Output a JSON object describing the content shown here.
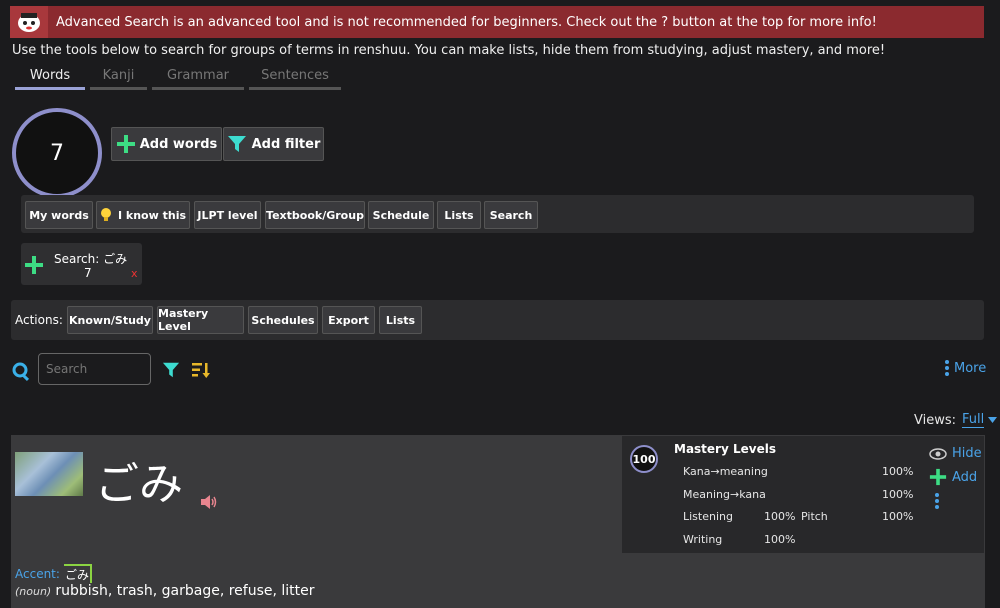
{
  "banner": {
    "text": "Advanced Search is an advanced tool and is not recommended for beginners. Check out the ? button at the top for more info!"
  },
  "intro": "Use the tools below to search for groups of terms in renshuu. You can make lists, hide them from studying, adjust mastery, and more!",
  "tabs": [
    "Words",
    "Kanji",
    "Grammar",
    "Sentences"
  ],
  "result_count": "7",
  "add_words_label": "Add words",
  "add_filter_label": "Add filter",
  "filters": [
    "My words",
    "I know this",
    "JLPT level",
    "Textbook/Group",
    "Schedule",
    "Lists",
    "Search"
  ],
  "search_chip": {
    "label": "Search:",
    "term": "ごみ",
    "count": "7",
    "remove": "x"
  },
  "actions": {
    "label": "Actions:",
    "buttons": [
      "Known/Study",
      "Mastery Level",
      "Schedules",
      "Export",
      "Lists"
    ]
  },
  "search": {
    "placeholder": "Search"
  },
  "more_label": "More",
  "views": {
    "label": "Views:",
    "value": "Full"
  },
  "entry": {
    "word": "ごみ",
    "accent_label": "Accent:",
    "accent_value": "ごみ",
    "pos": "(noun)",
    "meaning": "rubbish, trash, garbage, refuse, litter"
  },
  "mastery": {
    "score": "100",
    "title": "Mastery Levels",
    "kana_meaning_label": "Kana→meaning",
    "kana_meaning_value": "100%",
    "meaning_kana_label": "Meaning→kana",
    "meaning_kana_value": "100%",
    "listening_label": "Listening",
    "listening_value": "100%",
    "pitch_label": "Pitch",
    "pitch_value": "100%",
    "writing_label": "Writing",
    "writing_value": "100%"
  },
  "side_actions": {
    "hide": "Hide",
    "add": "Add"
  },
  "colors": {
    "banner": "#8b2a2f",
    "accent_green": "#3ddc84",
    "link_blue": "#4aa3e8",
    "ring": "#8e8fcb"
  }
}
